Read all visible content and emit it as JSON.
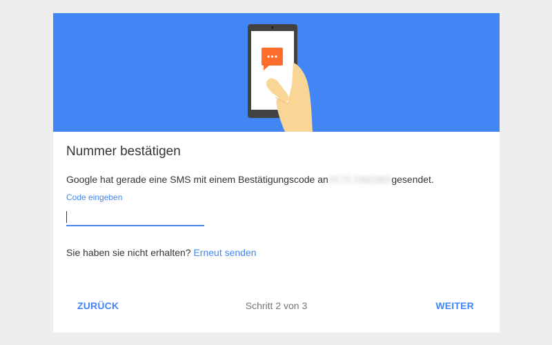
{
  "colors": {
    "accent": "#4285f4",
    "hero_bg": "#4285f4",
    "sms_bubble": "#ff6d2d",
    "page_bg": "#eeeeee"
  },
  "hero": {
    "illustration": "phone-with-sms-icon"
  },
  "dialog": {
    "title": "Nummer bestätigen",
    "message_prefix": "Google hat gerade eine SMS mit einem Bestätigungscode an",
    "phone_number_masked": "0173 2342363",
    "message_suffix": "gesendet.",
    "code_field": {
      "label": "Code eingeben",
      "value": ""
    },
    "resend": {
      "question": "Sie haben sie nicht erhalten?",
      "link_label": "Erneut senden"
    }
  },
  "footer": {
    "back_label": "ZURÜCK",
    "step_label": "Schritt 2 von 3",
    "next_label": "WEITER"
  }
}
